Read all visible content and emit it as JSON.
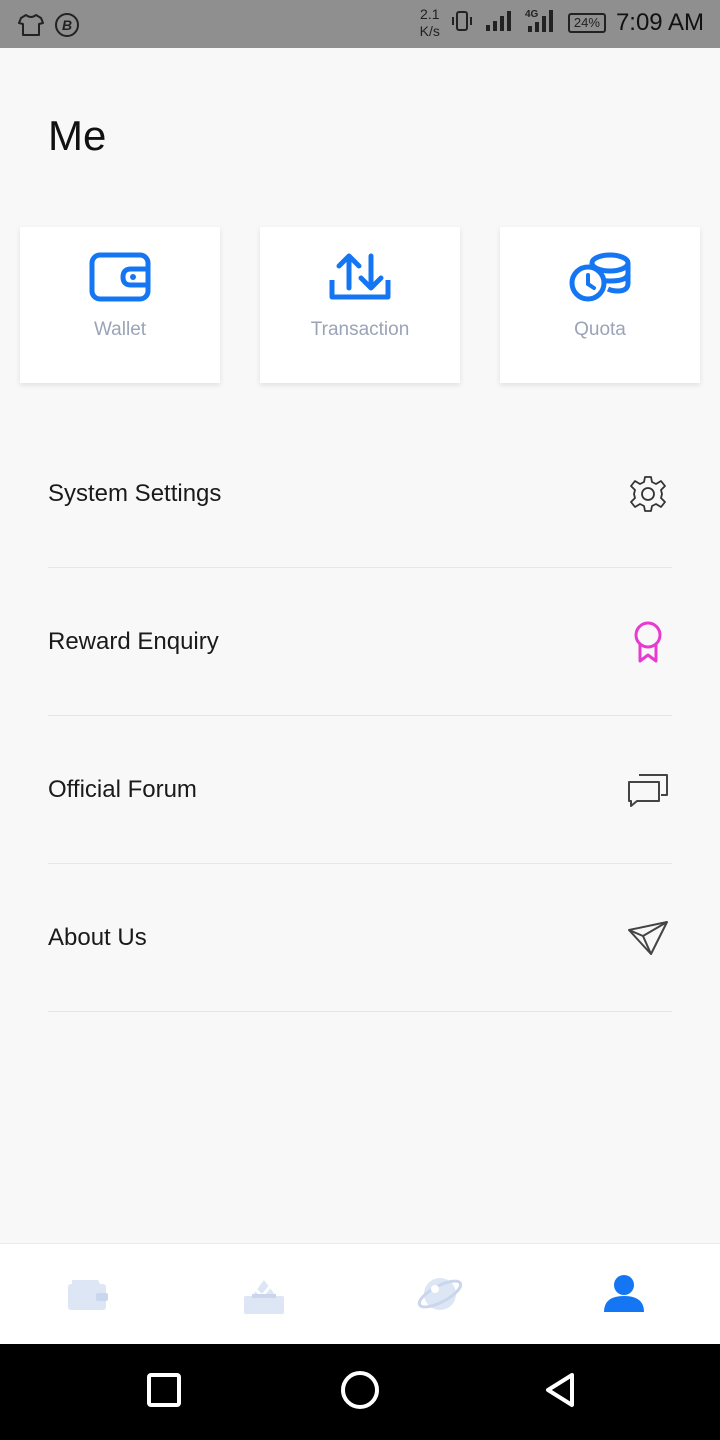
{
  "status_bar": {
    "speed_value": "2.1",
    "speed_unit": "K/s",
    "network": "4G",
    "battery": "24%",
    "time": "7:09 AM"
  },
  "page": {
    "title": "Me"
  },
  "cards": [
    {
      "label": "Wallet",
      "icon": "wallet-icon"
    },
    {
      "label": "Transaction",
      "icon": "transfer-arrows-icon"
    },
    {
      "label": "Quota",
      "icon": "coins-icon"
    }
  ],
  "menu": [
    {
      "label": "System Settings",
      "icon": "gear-icon"
    },
    {
      "label": "Reward Enquiry",
      "icon": "award-ribbon-icon"
    },
    {
      "label": "Official Forum",
      "icon": "chat-bubbles-icon"
    },
    {
      "label": "About Us",
      "icon": "paper-plane-icon"
    }
  ],
  "tabbar": {
    "items": [
      "wallet-tab-icon",
      "vote-tab-icon",
      "planet-tab-icon",
      "user-tab-icon"
    ],
    "active_index": 3
  },
  "colors": {
    "accent": "#1476f2",
    "inactive_tab": "#dde6f5",
    "card_label": "#9aa4b6",
    "reward_pink": "#e83ad0",
    "status_bar_bg": "#8f8f8f"
  }
}
